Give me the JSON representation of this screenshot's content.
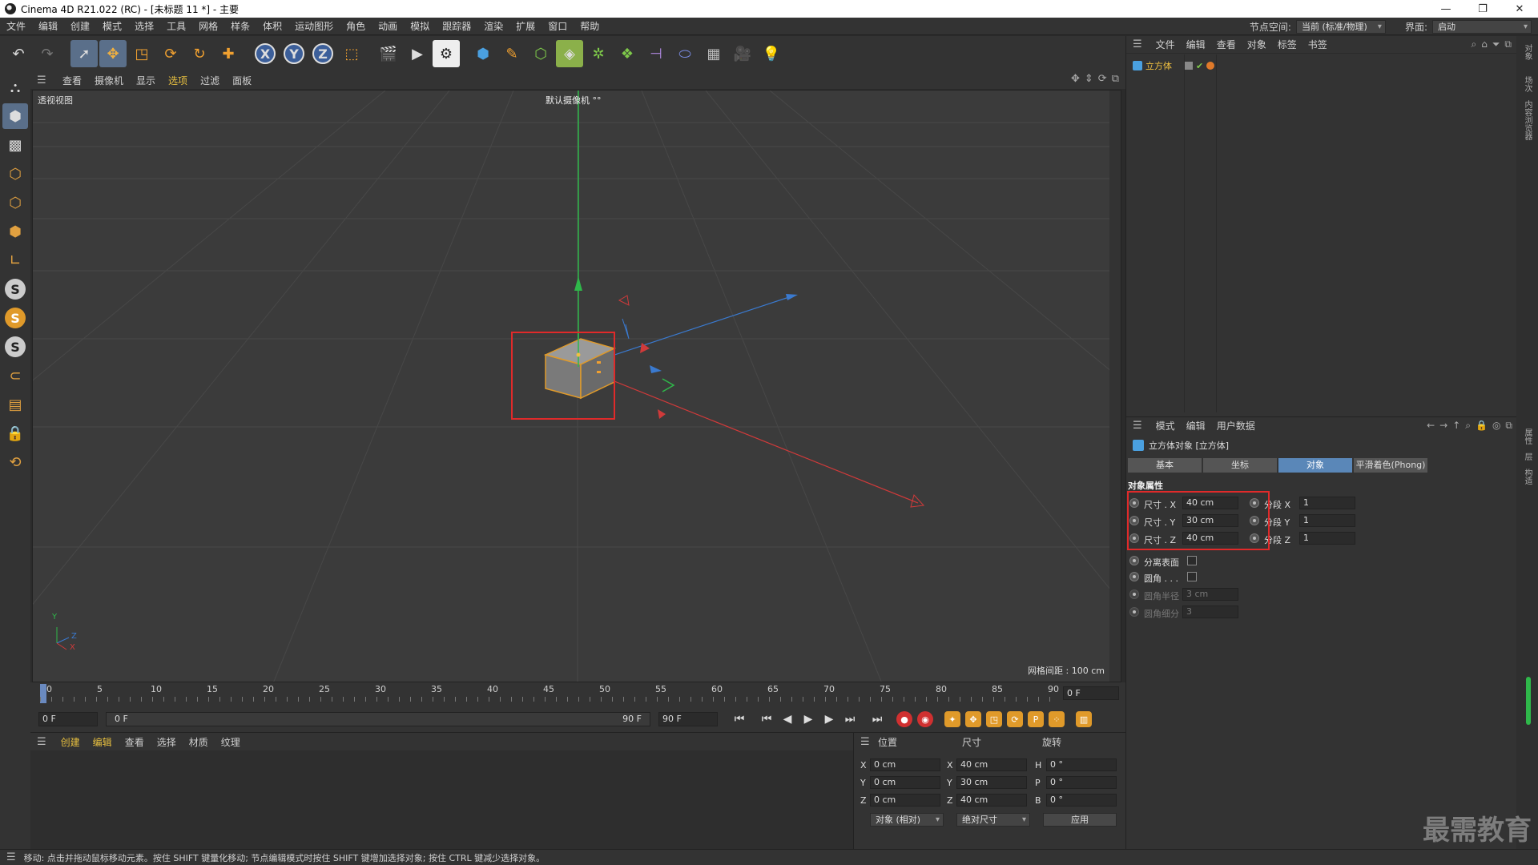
{
  "window": {
    "title": "Cinema 4D R21.022 (RC) - [未标题 11 *] - 主要",
    "min": "—",
    "max": "❐",
    "close": "✕"
  },
  "menubar": {
    "items": [
      "文件",
      "编辑",
      "创建",
      "模式",
      "选择",
      "工具",
      "网格",
      "样条",
      "体积",
      "运动图形",
      "角色",
      "动画",
      "模拟",
      "跟踪器",
      "渲染",
      "扩展",
      "窗口",
      "帮助"
    ],
    "node_space_label": "节点空间:",
    "node_space_value": "当前 (标准/物理)",
    "interface_label": "界面:",
    "interface_value": "启动"
  },
  "viewport": {
    "menu": [
      "查看",
      "摄像机",
      "显示",
      "选项",
      "过滤",
      "面板"
    ],
    "view_name": "透视视图",
    "camera_name": "默认摄像机 °°",
    "grid_spacing": "网格间距 : 100 cm",
    "axis_y": "Y",
    "axis_z": "Z",
    "axis_x": "X"
  },
  "timeline": {
    "ticks": [
      "0",
      "5",
      "10",
      "15",
      "20",
      "25",
      "30",
      "35",
      "40",
      "45",
      "50",
      "55",
      "60",
      "65",
      "70",
      "75",
      "80",
      "85",
      "90"
    ],
    "current_frame": "0 F"
  },
  "transport": {
    "start": "0 F",
    "min_field": "0 F",
    "end_inner": "90 F",
    "end": "90 F"
  },
  "material_panel": {
    "menu": [
      "创建",
      "编辑",
      "查看",
      "选择",
      "材质",
      "纹理"
    ]
  },
  "coord_panel": {
    "col_position": "位置",
    "col_size": "尺寸",
    "col_rotation": "旋转",
    "rows": [
      {
        "a1": "X",
        "pos": "0 cm",
        "a2": "X",
        "size": "40 cm",
        "a3": "H",
        "rot": "0 °"
      },
      {
        "a1": "Y",
        "pos": "0 cm",
        "a2": "Y",
        "size": "30 cm",
        "a3": "P",
        "rot": "0 °"
      },
      {
        "a1": "Z",
        "pos": "0 cm",
        "a2": "Z",
        "size": "40 cm",
        "a3": "B",
        "rot": "0 °"
      }
    ],
    "mode_value": "对象 (相对)",
    "size_mode_value": "绝对尺寸",
    "apply_label": "应用"
  },
  "object_manager": {
    "menu": [
      "文件",
      "编辑",
      "查看",
      "对象",
      "标签",
      "书签"
    ],
    "object_name": "立方体"
  },
  "attribute_manager": {
    "menu": [
      "模式",
      "编辑",
      "用户数据"
    ],
    "title": "立方体对象 [立方体]",
    "tabs": [
      "基本",
      "坐标",
      "对象",
      "平滑着色(Phong)"
    ],
    "active_tab": "对象",
    "section": "对象属性",
    "size_rows": [
      {
        "label": "尺寸 . X",
        "value": "40 cm",
        "seg_label": "分段 X",
        "seg_value": "1"
      },
      {
        "label": "尺寸 . Y",
        "value": "30 cm",
        "seg_label": "分段 Y",
        "seg_value": "1"
      },
      {
        "label": "尺寸 . Z",
        "value": "40 cm",
        "seg_label": "分段 Z",
        "seg_value": "1"
      }
    ],
    "separate_surfaces": "分离表面",
    "fillet": "圆角 . . .",
    "fillet_radius_label": "圆角半径",
    "fillet_radius_value": "3 cm",
    "fillet_subdiv_label": "圆角细分",
    "fillet_subdiv_value": "3"
  },
  "side_tabs": [
    "对象",
    "场次",
    "内容浏览器",
    "属性",
    "层",
    "构造"
  ],
  "status": {
    "message": "移动: 点击并拖动鼠标移动元素。按住 SHIFT 键量化移动; 节点编辑模式时按住 SHIFT 键增加选择对象; 按住 CTRL 键减少选择对象。"
  },
  "watermark": "最需教育",
  "colors": {
    "accent_blue": "#5a87b8",
    "highlight_red": "#e02a2a",
    "object_orange": "#e09a2a"
  }
}
